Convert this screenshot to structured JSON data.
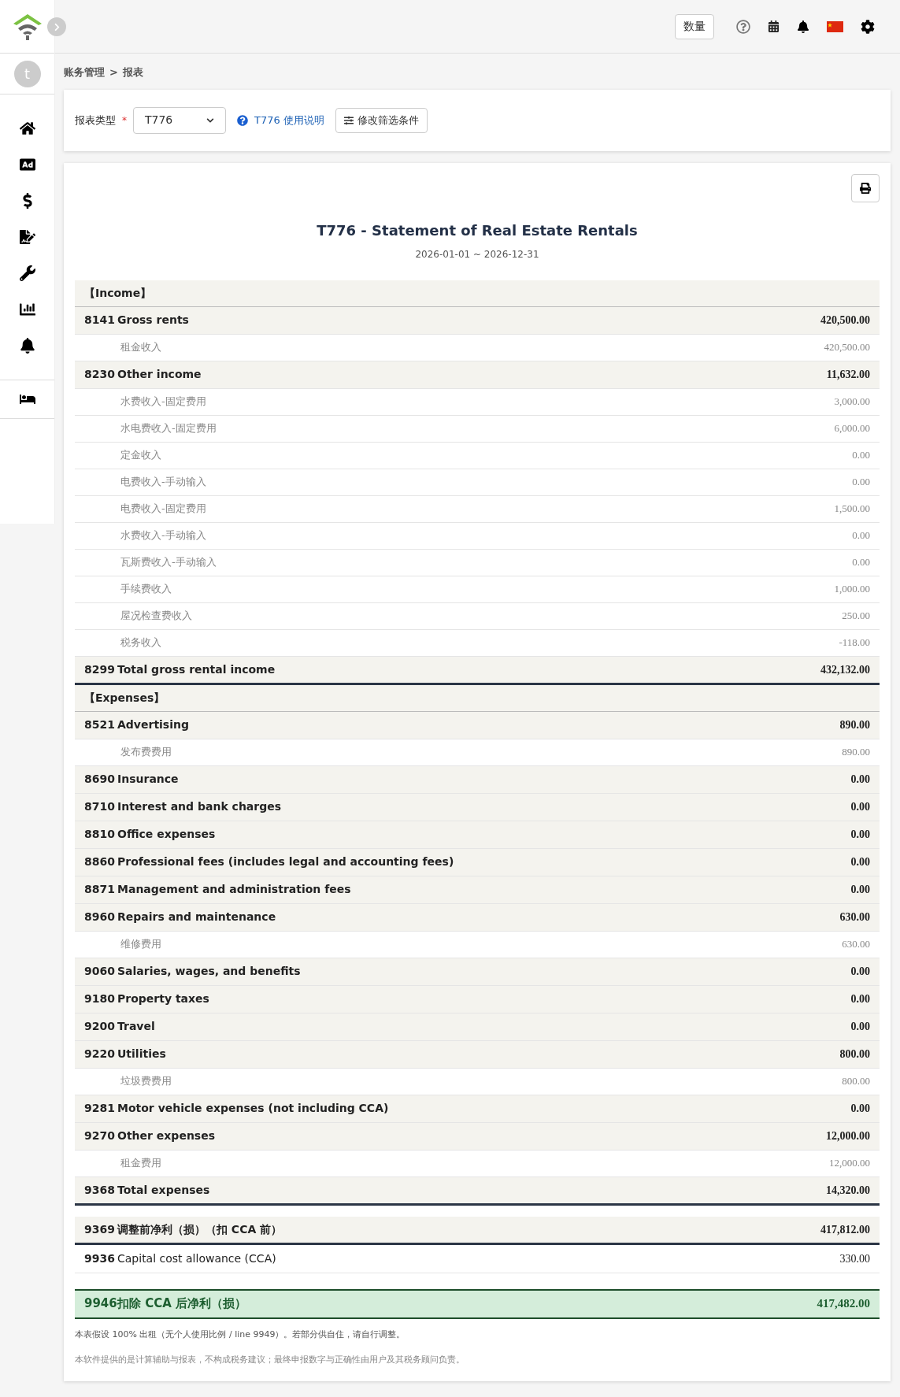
{
  "header": {
    "quantity_button": "数量"
  },
  "sidebar": {
    "avatar": "t",
    "items": [
      {
        "selected": false
      },
      {
        "selected": false
      },
      {
        "selected": false
      },
      {
        "selected": false
      },
      {
        "selected": false
      },
      {
        "selected": false
      },
      {
        "selected": false
      },
      {
        "selected": false
      }
    ]
  },
  "breadcrumb": [
    "账务管理",
    ">",
    "报表"
  ],
  "filter": {
    "label": "报表类型",
    "required_mark": "*",
    "select_value": "T776",
    "help_link": "T776 使用说明",
    "modify_button": "修改筛选条件"
  },
  "report": {
    "title": "T776 - Statement of Real Estate Rentals",
    "period": "2026-01-01 ~ 2026-12-31",
    "rows": [
      {
        "kind": "section",
        "label": "【Income】"
      },
      {
        "kind": "line",
        "code": "8141",
        "label": "Gross rents",
        "amount": "420,500.00"
      },
      {
        "kind": "detail",
        "label": "租金收入",
        "amount": "420,500.00"
      },
      {
        "kind": "line",
        "code": "8230",
        "label": "Other income",
        "amount": "11,632.00"
      },
      {
        "kind": "detail",
        "label": "水费收入-固定费用",
        "amount": "3,000.00"
      },
      {
        "kind": "detail",
        "label": "水电费收入-固定费用",
        "amount": "6,000.00"
      },
      {
        "kind": "detail",
        "label": "定金收入",
        "amount": "0.00"
      },
      {
        "kind": "detail",
        "label": "电费收入-手动输入",
        "amount": "0.00"
      },
      {
        "kind": "detail",
        "label": "电费收入-固定费用",
        "amount": "1,500.00"
      },
      {
        "kind": "detail",
        "label": "水费收入-手动输入",
        "amount": "0.00"
      },
      {
        "kind": "detail",
        "label": "瓦斯费收入-手动输入",
        "amount": "0.00"
      },
      {
        "kind": "detail",
        "label": "手续费收入",
        "amount": "1,000.00"
      },
      {
        "kind": "detail",
        "label": "屋况检查费收入",
        "amount": "250.00"
      },
      {
        "kind": "detail",
        "label": "税务收入",
        "amount": "-118.00"
      },
      {
        "kind": "total",
        "code": "8299",
        "label": "Total gross rental income",
        "amount": "432,132.00"
      },
      {
        "kind": "section",
        "label": "【Expenses】"
      },
      {
        "kind": "line",
        "code": "8521",
        "label": "Advertising",
        "amount": "890.00"
      },
      {
        "kind": "detail",
        "label": "发布费费用",
        "amount": "890.00"
      },
      {
        "kind": "line",
        "code": "8690",
        "label": "Insurance",
        "amount": "0.00"
      },
      {
        "kind": "line",
        "code": "8710",
        "label": "Interest and bank charges",
        "amount": "0.00"
      },
      {
        "kind": "line",
        "code": "8810",
        "label": "Office expenses",
        "amount": "0.00"
      },
      {
        "kind": "line",
        "code": "8860",
        "label": "Professional fees (includes legal and accounting fees)",
        "amount": "0.00"
      },
      {
        "kind": "line",
        "code": "8871",
        "label": "Management and administration fees",
        "amount": "0.00"
      },
      {
        "kind": "line",
        "code": "8960",
        "label": "Repairs and maintenance",
        "amount": "630.00"
      },
      {
        "kind": "detail",
        "label": "维修费用",
        "amount": "630.00"
      },
      {
        "kind": "line",
        "code": "9060",
        "label": "Salaries, wages, and benefits",
        "amount": "0.00"
      },
      {
        "kind": "line",
        "code": "9180",
        "label": "Property taxes",
        "amount": "0.00"
      },
      {
        "kind": "line",
        "code": "9200",
        "label": "Travel",
        "amount": "0.00"
      },
      {
        "kind": "line",
        "code": "9220",
        "label": "Utilities",
        "amount": "800.00"
      },
      {
        "kind": "detail",
        "label": "垃圾费费用",
        "amount": "800.00"
      },
      {
        "kind": "line",
        "code": "9281",
        "label": "Motor vehicle expenses (not including CCA)",
        "amount": "0.00"
      },
      {
        "kind": "line",
        "code": "9270",
        "label": "Other expenses",
        "amount": "12,000.00"
      },
      {
        "kind": "detail",
        "label": "租金费用",
        "amount": "12,000.00"
      },
      {
        "kind": "total",
        "code": "9368",
        "label": "Total expenses",
        "amount": "14,320.00"
      },
      {
        "kind": "subtotal",
        "code": "9369",
        "label": "调整前净利（损）（扣 CCA 前）",
        "amount": "417,812.00"
      },
      {
        "kind": "plain",
        "code": "9936",
        "label": "Capital cost allowance (CCA)",
        "amount": "330.00"
      },
      {
        "kind": "net",
        "code": "9946",
        "label": "扣除 CCA 后净利（损）",
        "amount": "417,482.00"
      }
    ],
    "notes": [
      "本表假设 100% 出租（无个人使用比例 / line 9949）。若部分供自住，请自行调整。",
      "本软件提供的是计算辅助与报表，不构成税务建议；最终申报数字与正确性由用户及其税务顾问负责。"
    ]
  }
}
